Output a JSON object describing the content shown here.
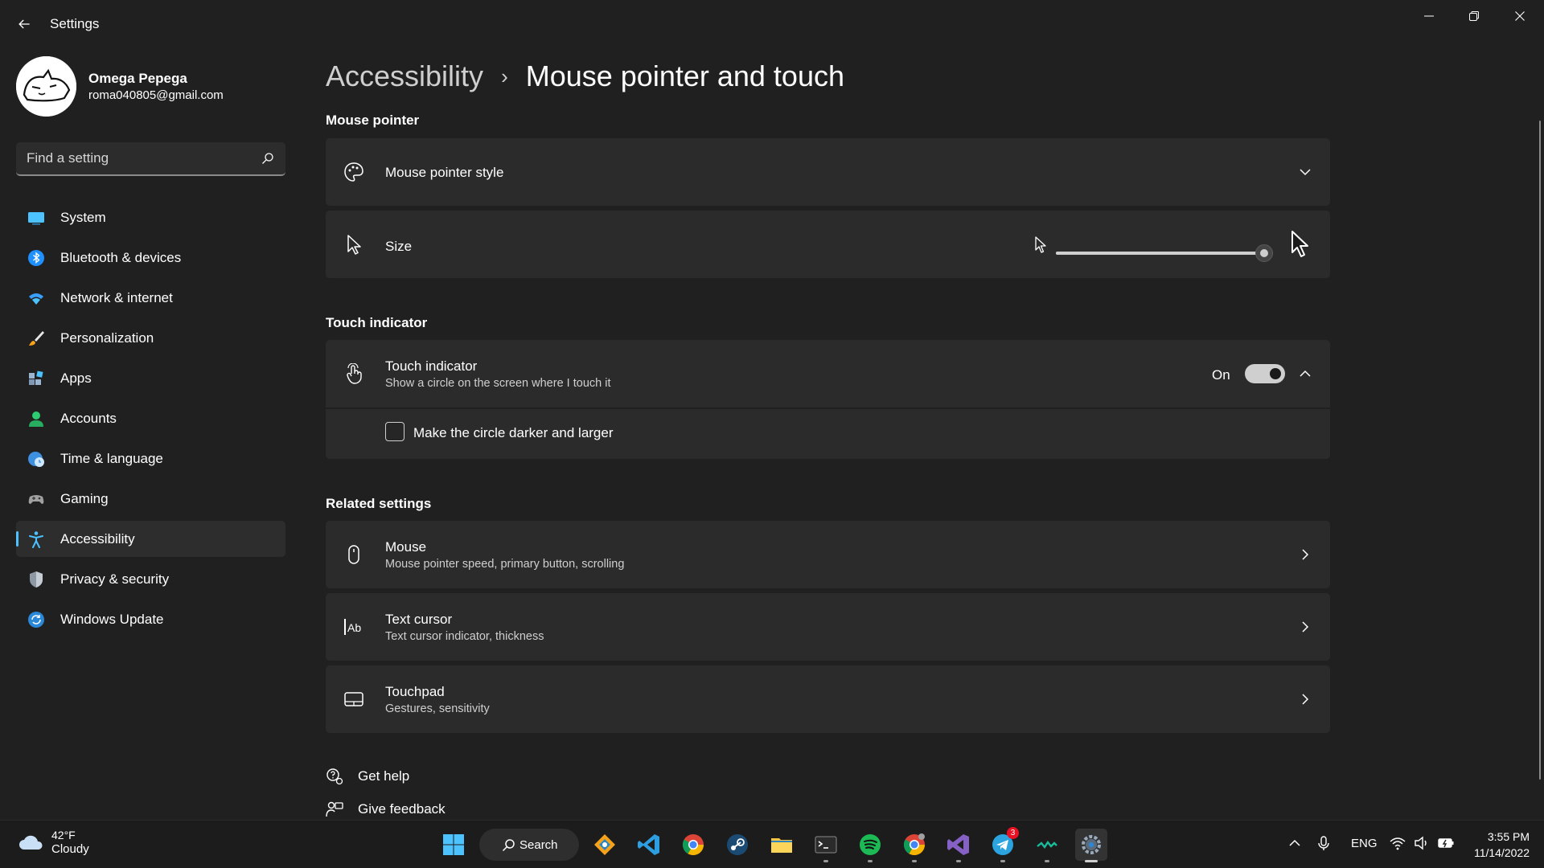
{
  "window": {
    "app_title": "Settings"
  },
  "profile": {
    "name": "Omega Pepega",
    "email": "roma040805@gmail.com"
  },
  "search": {
    "placeholder": "Find a setting"
  },
  "sidebar": {
    "items": [
      {
        "label": "System",
        "icon": "system-icon"
      },
      {
        "label": "Bluetooth & devices",
        "icon": "bluetooth-icon"
      },
      {
        "label": "Network & internet",
        "icon": "wifi-icon"
      },
      {
        "label": "Personalization",
        "icon": "brush-icon"
      },
      {
        "label": "Apps",
        "icon": "apps-icon"
      },
      {
        "label": "Accounts",
        "icon": "accounts-icon"
      },
      {
        "label": "Time & language",
        "icon": "globe-clock-icon"
      },
      {
        "label": "Gaming",
        "icon": "gamepad-icon"
      },
      {
        "label": "Accessibility",
        "icon": "accessibility-icon",
        "selected": true
      },
      {
        "label": "Privacy & security",
        "icon": "shield-icon"
      },
      {
        "label": "Windows Update",
        "icon": "update-icon"
      }
    ]
  },
  "breadcrumb": {
    "parent": "Accessibility",
    "separator": "›",
    "current": "Mouse pointer and touch"
  },
  "sections": {
    "mouse_pointer": {
      "title": "Mouse pointer",
      "style": {
        "label": "Mouse pointer style"
      },
      "size": {
        "label": "Size",
        "slider_value_fraction": 1.0
      }
    },
    "touch_indicator": {
      "title": "Touch indicator",
      "row": {
        "label": "Touch indicator",
        "description": "Show a circle on the screen where I touch it",
        "state_label": "On",
        "enabled": true
      },
      "option": {
        "label": "Make the circle darker and larger",
        "checked": false
      }
    },
    "related": {
      "title": "Related settings",
      "items": [
        {
          "label": "Mouse",
          "description": "Mouse pointer speed, primary button, scrolling",
          "icon": "mouse-icon"
        },
        {
          "label": "Text cursor",
          "description": "Text cursor indicator, thickness",
          "icon": "text-cursor-icon"
        },
        {
          "label": "Touchpad",
          "description": "Gestures, sensitivity",
          "icon": "touchpad-icon"
        }
      ]
    }
  },
  "help_links": {
    "get_help": "Get help",
    "give_feedback": "Give feedback"
  },
  "taskbar": {
    "weather": {
      "temp": "42°F",
      "condition": "Cloudy"
    },
    "search_label": "Search",
    "apps": [
      "start",
      "search",
      "sourcetree",
      "vscode",
      "chrome",
      "steam",
      "file-explorer",
      "terminal",
      "spotify",
      "chrome-profile",
      "visual-studio",
      "telegram",
      "waves",
      "settings"
    ],
    "telegram_badge": "3",
    "language": "ENG",
    "time": "3:55 PM",
    "date": "11/14/2022"
  },
  "colors": {
    "background": "#202020",
    "card": "#2b2b2b",
    "accent": "#4cc2ff",
    "taskbar": "#1c1c1c"
  }
}
